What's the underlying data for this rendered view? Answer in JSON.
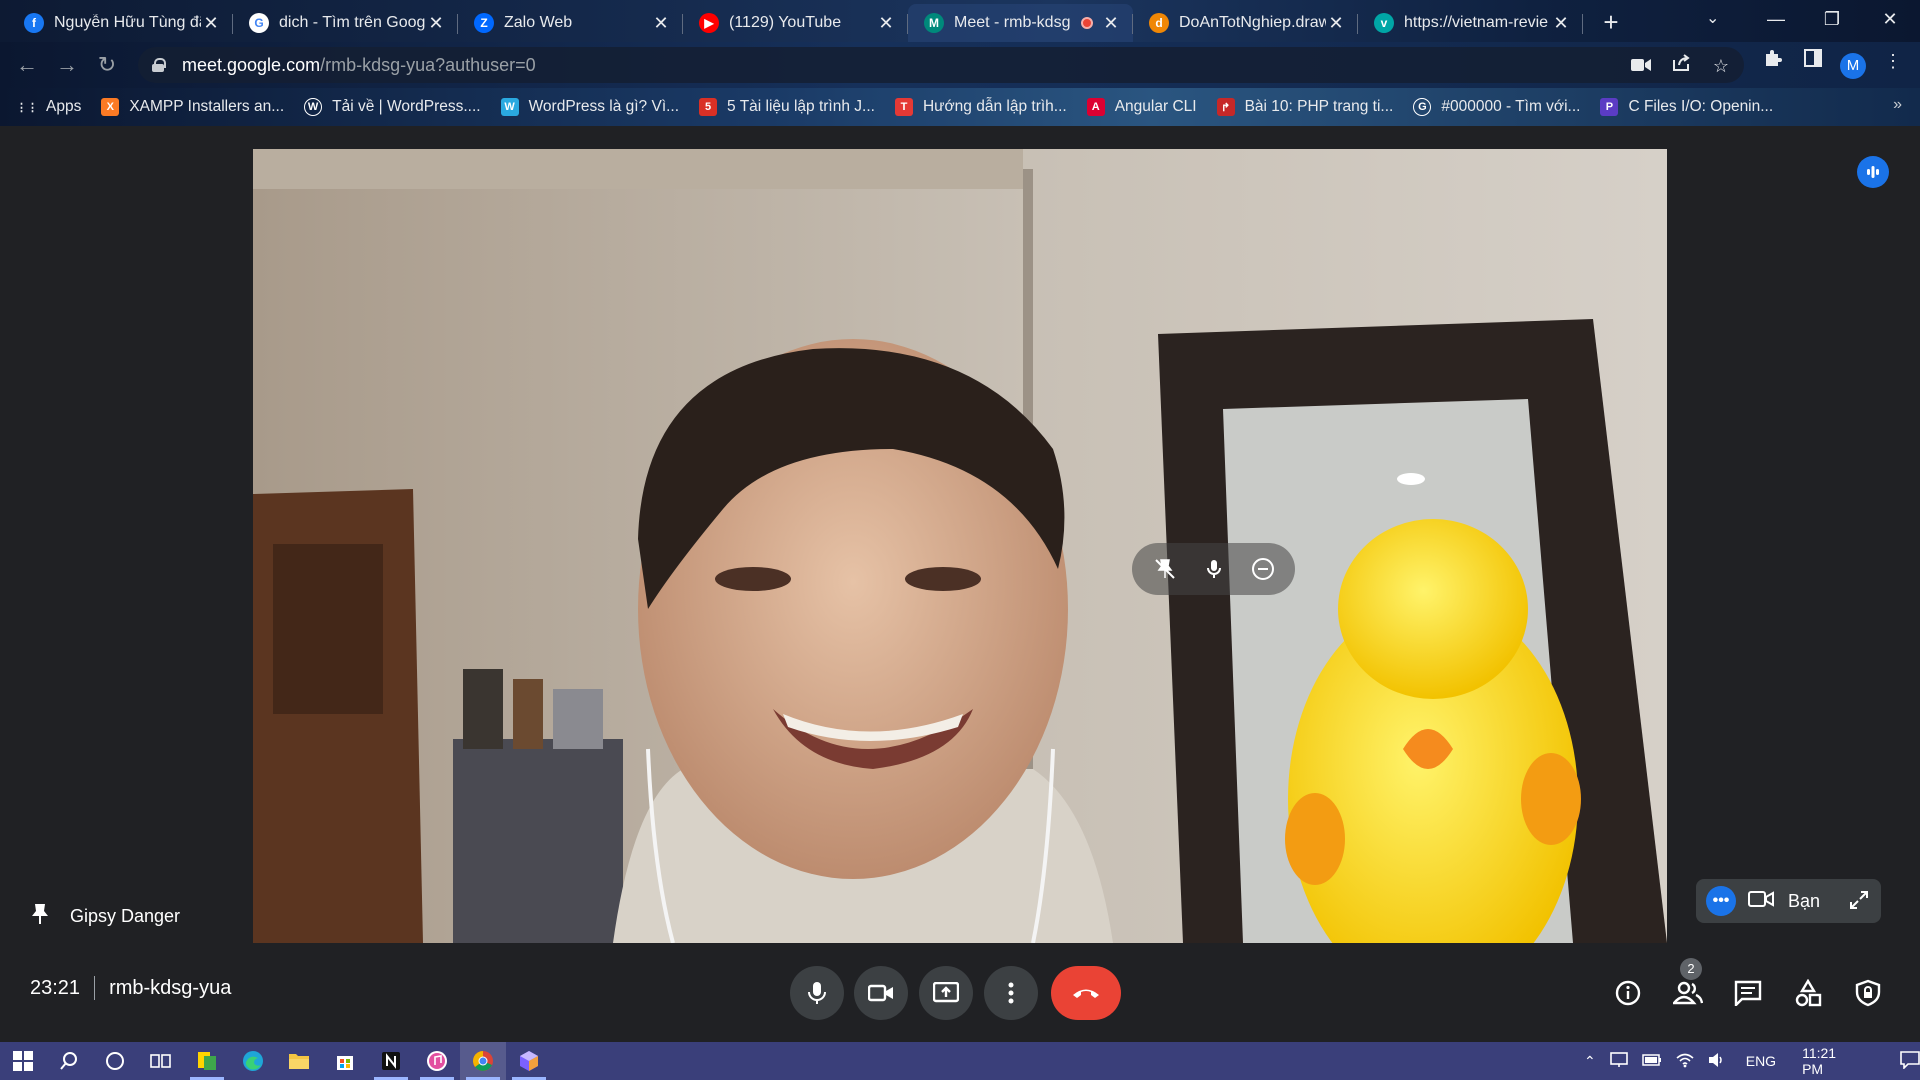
{
  "browser": {
    "tabs": [
      {
        "title": "Nguyễn Hữu Tùng đã",
        "icon": "facebook-icon",
        "color": "#1877f2",
        "glyph": "f",
        "active": false
      },
      {
        "title": "dich - Tìm trên Google",
        "icon": "google-icon",
        "color": "#ffffff",
        "glyph": "G",
        "active": false
      },
      {
        "title": "Zalo Web",
        "icon": "zalo-icon",
        "color": "#0068ff",
        "glyph": "Z",
        "active": false
      },
      {
        "title": "(1129) YouTube",
        "icon": "youtube-icon",
        "color": "#ff0000",
        "glyph": "▶",
        "active": false
      },
      {
        "title": "Meet - rmb-kdsg",
        "icon": "meet-icon",
        "color": "#00897b",
        "glyph": "M",
        "active": true
      },
      {
        "title": "DoAnTotNghiep.draw",
        "icon": "drawio-icon",
        "color": "#f08705",
        "glyph": "d",
        "active": false
      },
      {
        "title": "https://vietnam-revie",
        "icon": "globe-icon",
        "color": "#00a6a6",
        "glyph": "v",
        "active": false
      }
    ],
    "url_host": "meet.google.com",
    "url_path": "/rmb-kdsg-yua?authuser=0",
    "profile_initial": "M",
    "bookmarks": [
      {
        "label": "Apps",
        "icon": "apps-grid-icon",
        "color": "#e8eaed",
        "glyph": "⋮⋮"
      },
      {
        "label": "XAMPP Installers an...",
        "icon": "xampp-icon",
        "color": "#fb7a24",
        "glyph": "X"
      },
      {
        "label": "Tải về | WordPress....",
        "icon": "wordpress-icon",
        "color": "#ffffff",
        "glyph": "W"
      },
      {
        "label": "WordPress là gì? Vì...",
        "icon": "wordpress-blue-icon",
        "color": "#2aa9e0",
        "glyph": "W"
      },
      {
        "label": "5 Tài liệu lập trình J...",
        "icon": "bookmark-site-icon",
        "color": "#d93025",
        "glyph": "5"
      },
      {
        "label": "Hướng dẫn lập trìh...",
        "icon": "t-site-icon",
        "color": "#e53935",
        "glyph": "T"
      },
      {
        "label": "Angular CLI",
        "icon": "angular-icon",
        "color": "#dd0031",
        "glyph": "A"
      },
      {
        "label": "Bài 10: PHP trang ti...",
        "icon": "arrow-site-icon",
        "color": "#c62828",
        "glyph": "↱"
      },
      {
        "label": "#000000 - Tìm với...",
        "icon": "google-icon",
        "color": "#ffffff",
        "glyph": "G"
      },
      {
        "label": "C Files I/O: Openin...",
        "icon": "programiz-icon",
        "color": "#5b3cc4",
        "glyph": "P"
      }
    ]
  },
  "meet": {
    "presenter_name": "Gipsy Danger",
    "self_label": "Bạn",
    "time": "23:21",
    "meeting_code": "rmb-kdsg-yua",
    "participants_count": "2",
    "end_color": "#ea4335",
    "accent": "#1a73e8"
  },
  "taskbar": {
    "language": "ENG",
    "clock": "11:21 PM"
  }
}
